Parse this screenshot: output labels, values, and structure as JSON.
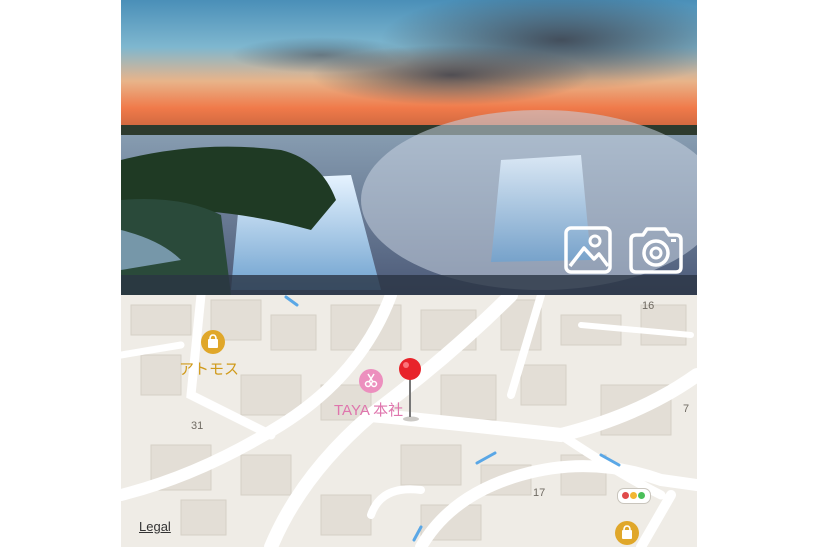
{
  "photo": {
    "gallery_icon": "image-gallery-icon",
    "camera_icon": "camera-icon"
  },
  "map": {
    "pois": [
      {
        "label": "アトモス",
        "icon": "shopping-bag-icon",
        "color": "#d4a017"
      },
      {
        "label": "TAYA 本社",
        "icon": "scissors-icon",
        "color": "#e07bb0"
      }
    ],
    "street_numbers": [
      "16",
      "31",
      "7",
      "17"
    ],
    "legal": "Legal",
    "pin_icon": "location-pin-icon",
    "traffic_icon": "traffic-light-icon"
  }
}
